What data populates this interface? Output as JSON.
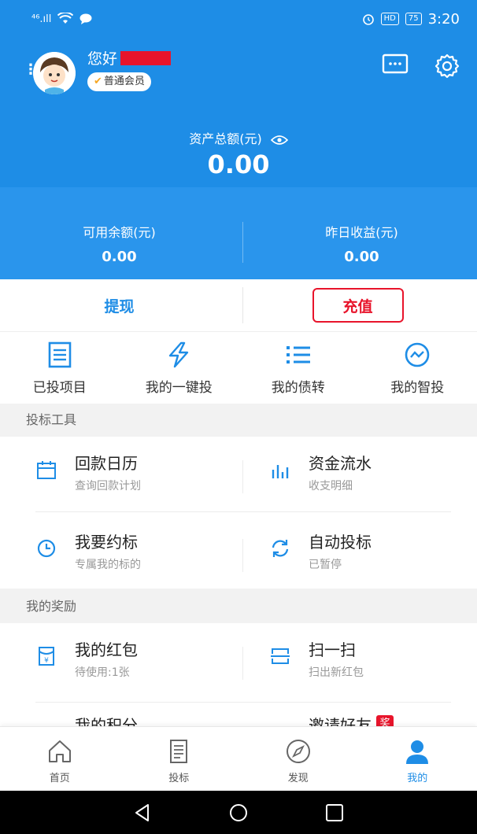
{
  "status_bar": {
    "signal_text": "⁴⁶.ıll",
    "hd_label": "HD",
    "battery": "75",
    "time": "3:20"
  },
  "header": {
    "greeting": "您好",
    "member_level": "普通会员",
    "total_assets_label": "资产总额(元)",
    "total_assets_value": "0.00",
    "available_balance_label": "可用余额(元)",
    "available_balance_value": "0.00",
    "yesterday_earnings_label": "昨日收益(元)",
    "yesterday_earnings_value": "0.00"
  },
  "actions": {
    "withdraw": "提现",
    "recharge": "充值"
  },
  "quick_links": [
    {
      "label": "已投项目",
      "icon": "list-document-icon"
    },
    {
      "label": "我的一键投",
      "icon": "lightning-icon"
    },
    {
      "label": "我的债转",
      "icon": "bullet-list-icon"
    },
    {
      "label": "我的智投",
      "icon": "trend-circle-icon"
    }
  ],
  "tools_section": {
    "title": "投标工具",
    "items": [
      {
        "title": "回款日历",
        "subtitle": "查询回款计划",
        "icon": "calendar-icon"
      },
      {
        "title": "资金流水",
        "subtitle": "收支明细",
        "icon": "bar-chart-icon"
      },
      {
        "title": "我要约标",
        "subtitle": "专属我的标的",
        "icon": "clock-icon"
      },
      {
        "title": "自动投标",
        "subtitle": "已暂停",
        "icon": "refresh-icon"
      }
    ]
  },
  "rewards_section": {
    "title": "我的奖励",
    "items": [
      {
        "title": "我的红包",
        "subtitle": "待使用:1张",
        "icon": "red-envelope-icon"
      },
      {
        "title": "扫一扫",
        "subtitle": "扫出新红包",
        "icon": "scan-icon"
      },
      {
        "title": "我的积分",
        "subtitle": "",
        "icon": "coins-icon"
      },
      {
        "title": "邀请好友",
        "subtitle": "",
        "icon": "invite-icon",
        "badge": "奖"
      }
    ]
  },
  "tab_bar": [
    {
      "label": "首页",
      "icon": "home-icon"
    },
    {
      "label": "投标",
      "icon": "document-icon"
    },
    {
      "label": "发现",
      "icon": "compass-icon"
    },
    {
      "label": "我的",
      "icon": "person-icon",
      "active": true
    }
  ],
  "colors": {
    "primary": "#1e8de6",
    "accent_red": "#e8142b"
  }
}
